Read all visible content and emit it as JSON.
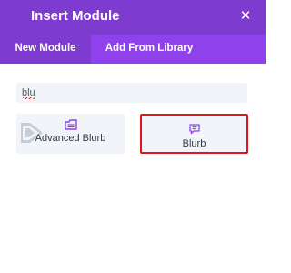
{
  "header": {
    "title": "Insert Module",
    "close_icon": "✕"
  },
  "tabs": [
    {
      "label": "New Module",
      "active": true
    },
    {
      "label": "Add From Library",
      "active": false
    }
  ],
  "search": {
    "value": "blu"
  },
  "modules": [
    {
      "label": "Advanced Blurb",
      "icon": "advanced-blurb-icon",
      "badge": "divi-plus-logo"
    },
    {
      "label": "Blurb",
      "icon": "blurb-icon",
      "highlighted": true
    }
  ],
  "colors": {
    "header": "#7e3bd0",
    "tabs": "#8f42ec",
    "accent": "#8f42ec",
    "card_bg": "#f1f5f9",
    "highlight": "#e0161f"
  }
}
